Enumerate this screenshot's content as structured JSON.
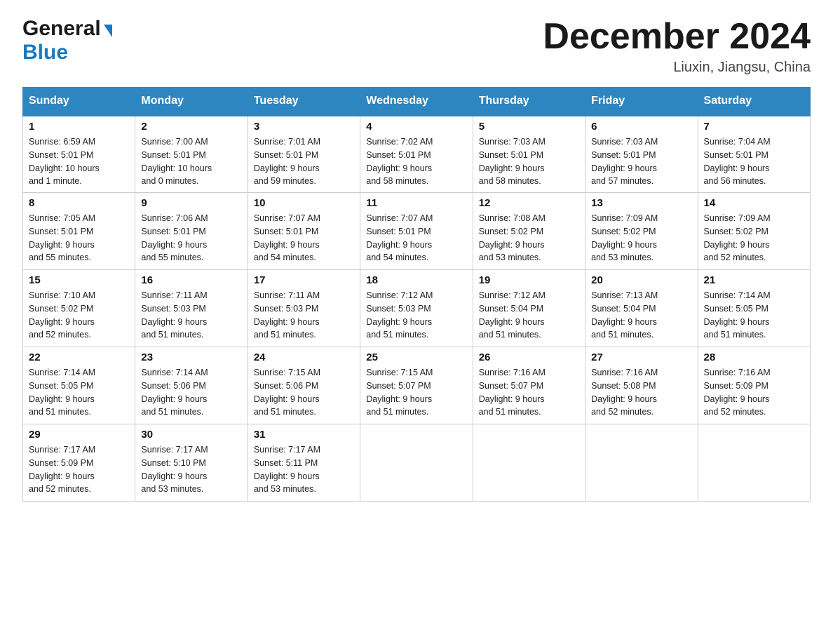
{
  "header": {
    "logo_general": "General",
    "logo_blue": "Blue",
    "month_title": "December 2024",
    "location": "Liuxin, Jiangsu, China"
  },
  "days_of_week": [
    "Sunday",
    "Monday",
    "Tuesday",
    "Wednesday",
    "Thursday",
    "Friday",
    "Saturday"
  ],
  "weeks": [
    [
      {
        "day": "1",
        "sunrise": "6:59 AM",
        "sunset": "5:01 PM",
        "daylight": "10 hours and 1 minute."
      },
      {
        "day": "2",
        "sunrise": "7:00 AM",
        "sunset": "5:01 PM",
        "daylight": "10 hours and 0 minutes."
      },
      {
        "day": "3",
        "sunrise": "7:01 AM",
        "sunset": "5:01 PM",
        "daylight": "9 hours and 59 minutes."
      },
      {
        "day": "4",
        "sunrise": "7:02 AM",
        "sunset": "5:01 PM",
        "daylight": "9 hours and 58 minutes."
      },
      {
        "day": "5",
        "sunrise": "7:03 AM",
        "sunset": "5:01 PM",
        "daylight": "9 hours and 58 minutes."
      },
      {
        "day": "6",
        "sunrise": "7:03 AM",
        "sunset": "5:01 PM",
        "daylight": "9 hours and 57 minutes."
      },
      {
        "day": "7",
        "sunrise": "7:04 AM",
        "sunset": "5:01 PM",
        "daylight": "9 hours and 56 minutes."
      }
    ],
    [
      {
        "day": "8",
        "sunrise": "7:05 AM",
        "sunset": "5:01 PM",
        "daylight": "9 hours and 55 minutes."
      },
      {
        "day": "9",
        "sunrise": "7:06 AM",
        "sunset": "5:01 PM",
        "daylight": "9 hours and 55 minutes."
      },
      {
        "day": "10",
        "sunrise": "7:07 AM",
        "sunset": "5:01 PM",
        "daylight": "9 hours and 54 minutes."
      },
      {
        "day": "11",
        "sunrise": "7:07 AM",
        "sunset": "5:01 PM",
        "daylight": "9 hours and 54 minutes."
      },
      {
        "day": "12",
        "sunrise": "7:08 AM",
        "sunset": "5:02 PM",
        "daylight": "9 hours and 53 minutes."
      },
      {
        "day": "13",
        "sunrise": "7:09 AM",
        "sunset": "5:02 PM",
        "daylight": "9 hours and 53 minutes."
      },
      {
        "day": "14",
        "sunrise": "7:09 AM",
        "sunset": "5:02 PM",
        "daylight": "9 hours and 52 minutes."
      }
    ],
    [
      {
        "day": "15",
        "sunrise": "7:10 AM",
        "sunset": "5:02 PM",
        "daylight": "9 hours and 52 minutes."
      },
      {
        "day": "16",
        "sunrise": "7:11 AM",
        "sunset": "5:03 PM",
        "daylight": "9 hours and 51 minutes."
      },
      {
        "day": "17",
        "sunrise": "7:11 AM",
        "sunset": "5:03 PM",
        "daylight": "9 hours and 51 minutes."
      },
      {
        "day": "18",
        "sunrise": "7:12 AM",
        "sunset": "5:03 PM",
        "daylight": "9 hours and 51 minutes."
      },
      {
        "day": "19",
        "sunrise": "7:12 AM",
        "sunset": "5:04 PM",
        "daylight": "9 hours and 51 minutes."
      },
      {
        "day": "20",
        "sunrise": "7:13 AM",
        "sunset": "5:04 PM",
        "daylight": "9 hours and 51 minutes."
      },
      {
        "day": "21",
        "sunrise": "7:14 AM",
        "sunset": "5:05 PM",
        "daylight": "9 hours and 51 minutes."
      }
    ],
    [
      {
        "day": "22",
        "sunrise": "7:14 AM",
        "sunset": "5:05 PM",
        "daylight": "9 hours and 51 minutes."
      },
      {
        "day": "23",
        "sunrise": "7:14 AM",
        "sunset": "5:06 PM",
        "daylight": "9 hours and 51 minutes."
      },
      {
        "day": "24",
        "sunrise": "7:15 AM",
        "sunset": "5:06 PM",
        "daylight": "9 hours and 51 minutes."
      },
      {
        "day": "25",
        "sunrise": "7:15 AM",
        "sunset": "5:07 PM",
        "daylight": "9 hours and 51 minutes."
      },
      {
        "day": "26",
        "sunrise": "7:16 AM",
        "sunset": "5:07 PM",
        "daylight": "9 hours and 51 minutes."
      },
      {
        "day": "27",
        "sunrise": "7:16 AM",
        "sunset": "5:08 PM",
        "daylight": "9 hours and 52 minutes."
      },
      {
        "day": "28",
        "sunrise": "7:16 AM",
        "sunset": "5:09 PM",
        "daylight": "9 hours and 52 minutes."
      }
    ],
    [
      {
        "day": "29",
        "sunrise": "7:17 AM",
        "sunset": "5:09 PM",
        "daylight": "9 hours and 52 minutes."
      },
      {
        "day": "30",
        "sunrise": "7:17 AM",
        "sunset": "5:10 PM",
        "daylight": "9 hours and 53 minutes."
      },
      {
        "day": "31",
        "sunrise": "7:17 AM",
        "sunset": "5:11 PM",
        "daylight": "9 hours and 53 minutes."
      },
      null,
      null,
      null,
      null
    ]
  ],
  "labels": {
    "sunrise": "Sunrise:",
    "sunset": "Sunset:",
    "daylight": "Daylight:"
  }
}
